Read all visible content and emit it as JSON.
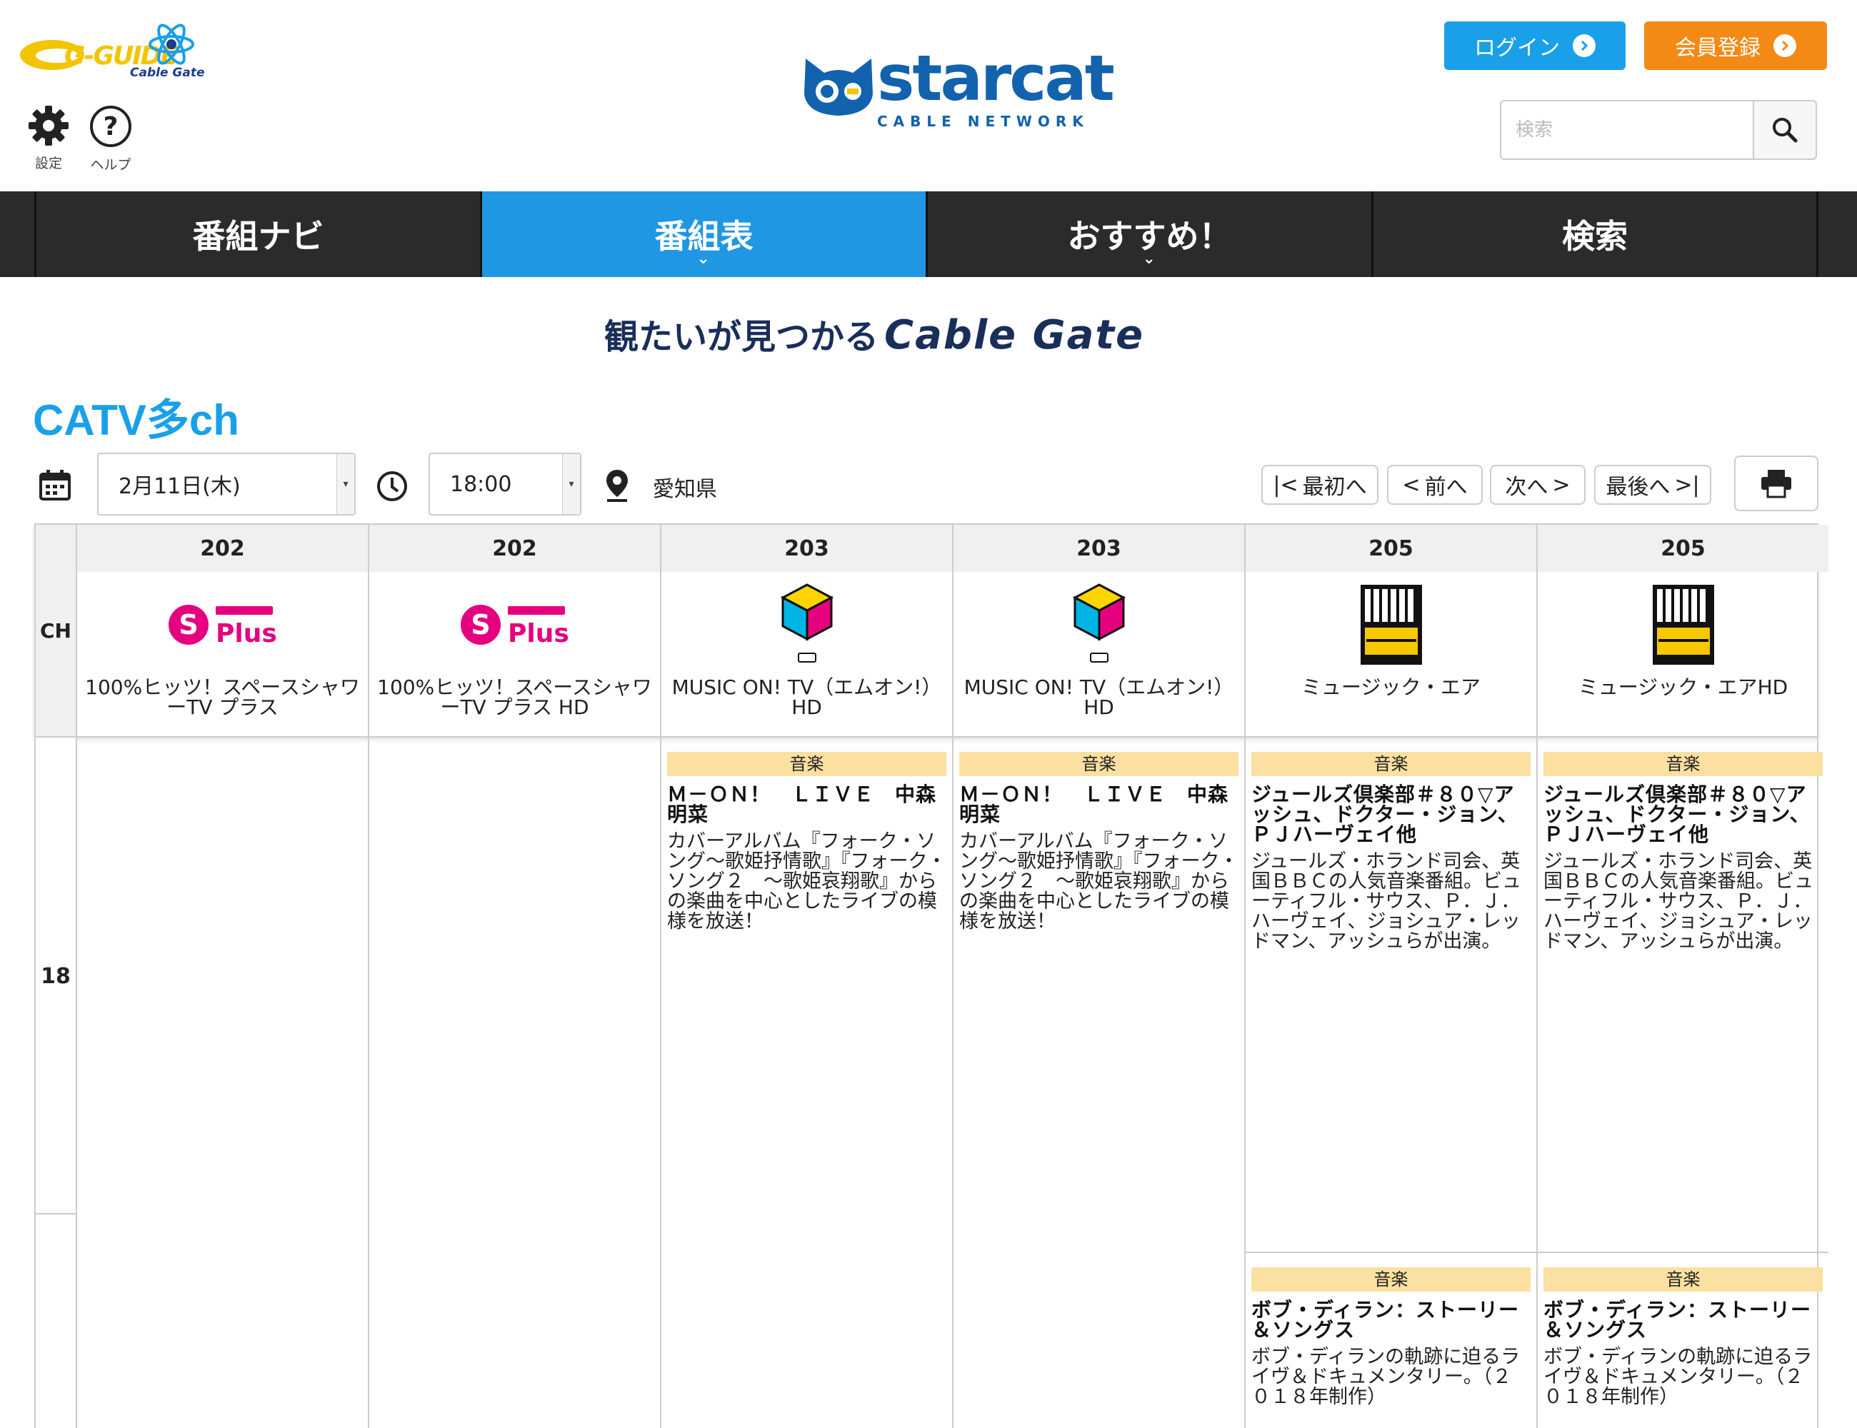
{
  "header": {
    "gguide_logo": "G-GUIDE",
    "cablegate_logo": "Cable Gate",
    "settings_label": "設定",
    "help_label": "ヘルプ",
    "brand_logo": "starcat",
    "brand_sub": "CABLE NETWORK",
    "login_label": "ログイン",
    "register_label": "会員登録",
    "search_placeholder": "検索",
    "accent_blue": "#1aa0e8",
    "accent_orange": "#f38a16"
  },
  "nav": {
    "items": [
      {
        "label": "番組ナビ"
      },
      {
        "label": "番組表"
      },
      {
        "label": "おすすめ！"
      },
      {
        "label": "検索"
      }
    ],
    "active": "番組表"
  },
  "banner": {
    "text": "観たいが見つかる",
    "brand": "Cable Gate"
  },
  "page": {
    "title": "CATV多ch"
  },
  "filters": {
    "date": "2月11日(木)",
    "time": "18:00",
    "region": "愛知県"
  },
  "pager": {
    "first": "最初へ",
    "prev": "前へ",
    "next": "次へ",
    "last": "最後へ"
  },
  "grid": {
    "ch_header": "CH",
    "hour": "18",
    "channels": [
      {
        "number": "202",
        "name": "100%ヒッツ！スペースシャワーTV プラス",
        "logo": "space-shower-plus-logo"
      },
      {
        "number": "202",
        "name": "100%ヒッツ！スペースシャワーTV プラス HD",
        "logo": "space-shower-plus-logo"
      },
      {
        "number": "203",
        "name": "MUSIC ON! TV（エムオン!）HD",
        "logo": "music-on-tv-logo"
      },
      {
        "number": "203",
        "name": "MUSIC ON! TV（エムオン!）HD",
        "logo": "music-on-tv-logo"
      },
      {
        "number": "205",
        "name": "ミュージック・エア",
        "logo": "music-air-logo"
      },
      {
        "number": "205",
        "name": "ミュージック・エアHD",
        "logo": "music-air-logo"
      }
    ],
    "programs": {
      "mon1": {
        "genre": "音楽",
        "title": "Ｍ－ＯＮ！　ＬＩＶＥ　中森明菜",
        "desc": "カバーアルバム『フォーク・ソング～歌姫抒情歌』『フォーク・ソング２　～歌姫哀翔歌』からの楽曲を中心としたライブの模様を放送！"
      },
      "mon2": {
        "genre": "音楽",
        "title": "Ｍ－ＯＮ！　ＬＩＶＥ　中森明菜",
        "desc": "カバーアルバム『フォーク・ソング～歌姫抒情歌』『フォーク・ソング２　～歌姫哀翔歌』からの楽曲を中心としたライブの模様を放送！"
      },
      "air1a": {
        "genre": "音楽",
        "title": "ジュールズ倶楽部＃８０▽アッシュ、ドクター・ジョン、ＰＪハーヴェイ他",
        "desc": "ジュールズ・ホランド司会、英国ＢＢＣの人気音楽番組。ビューティフル・サウス、Ｐ．Ｊ．　ハーヴェイ、ジョシュア・レッドマン、アッシュらが出演。"
      },
      "air2a": {
        "genre": "音楽",
        "title": "ジュールズ倶楽部＃８０▽アッシュ、ドクター・ジョン、ＰＪハーヴェイ他",
        "desc": "ジュールズ・ホランド司会、英国ＢＢＣの人気音楽番組。ビューティフル・サウス、Ｐ．Ｊ．　ハーヴェイ、ジョシュア・レッドマン、アッシュらが出演。"
      },
      "air1b": {
        "genre": "音楽",
        "title": "ボブ・ディラン：ストーリー＆ソングス",
        "desc": "ボブ・ディランの軌跡に迫るライヴ＆ドキュメンタリー。（２０１８年制作）"
      },
      "air2b": {
        "genre": "音楽",
        "title": "ボブ・ディラン：ストーリー＆ソングス",
        "desc": "ボブ・ディランの軌跡に迫るライヴ＆ドキュメンタリー。（２０１８年制作）"
      }
    }
  },
  "colors": {
    "nav_bg": "#2b2b2b",
    "nav_active": "#1f97e3",
    "genre_bg": "#fbe0a1",
    "title_blue": "#1aa0e8"
  }
}
